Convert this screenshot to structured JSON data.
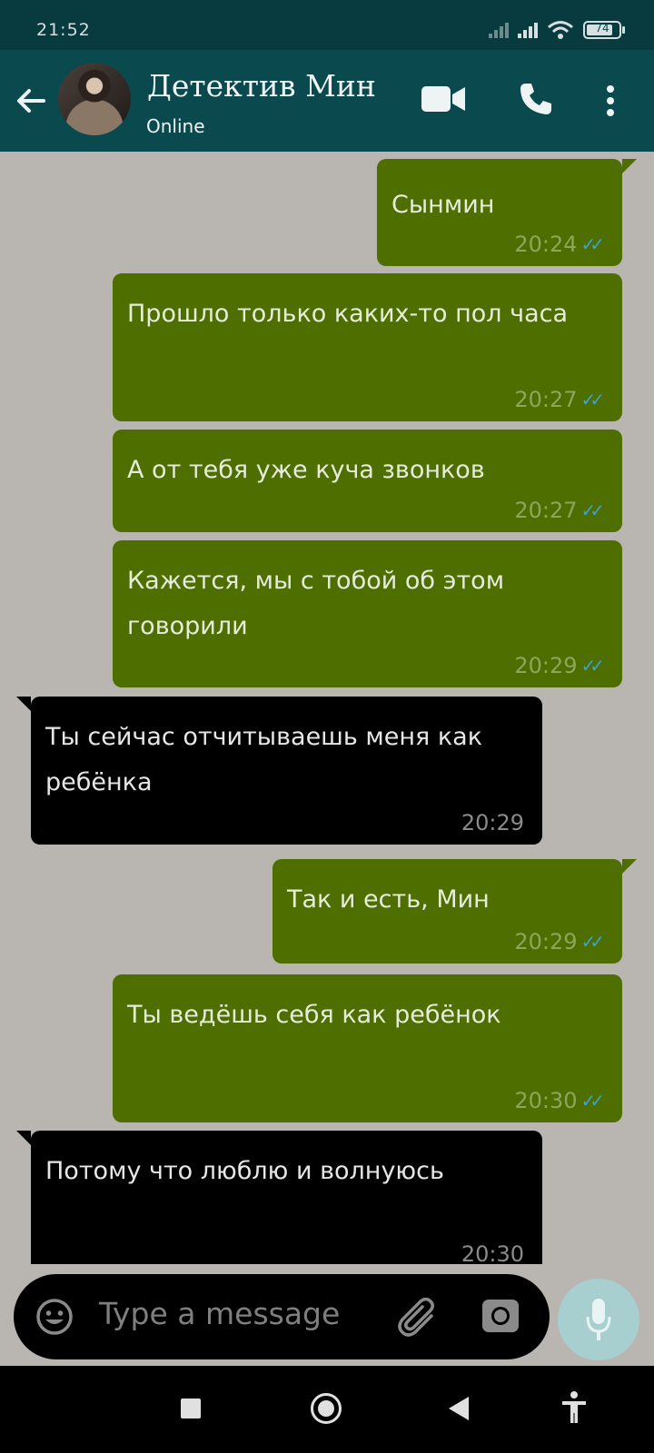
{
  "status_bar": {
    "time": "21:52",
    "battery": "74"
  },
  "header": {
    "contact_name": "Детектив Мин",
    "contact_status": "Online",
    "icons": [
      "back-arrow-icon",
      "video-call-icon",
      "phone-icon",
      "more-vert-icon"
    ]
  },
  "messages": [
    {
      "dir": "out",
      "text": "Сынмин",
      "time": "20:24",
      "read": true
    },
    {
      "dir": "out",
      "text": "Прошло только каких-то пол часа",
      "time": "20:27",
      "read": true
    },
    {
      "dir": "out",
      "text": "А от тебя уже куча звонков",
      "time": "20:27",
      "read": true
    },
    {
      "dir": "out",
      "text": "Кажется, мы с тобой об этом говорили",
      "time": "20:29",
      "read": true
    },
    {
      "dir": "in",
      "text": "Ты сейчас отчитываешь меня как ребёнка",
      "time": "20:29"
    },
    {
      "dir": "out",
      "text": "Так и есть, Мин",
      "time": "20:29",
      "read": true
    },
    {
      "dir": "out",
      "text": "Ты ведёшь себя как ребёнок",
      "time": "20:30",
      "read": true
    },
    {
      "dir": "in",
      "text": "Потому что люблю и волнуюсь",
      "time": "20:30"
    }
  ],
  "input": {
    "placeholder": "Type a message"
  },
  "colors": {
    "header": "#0a4a4e",
    "outgoing": "#4e6e00",
    "incoming": "#000000",
    "tick": "#3aa2d6",
    "mic": "#a7cfcf"
  }
}
